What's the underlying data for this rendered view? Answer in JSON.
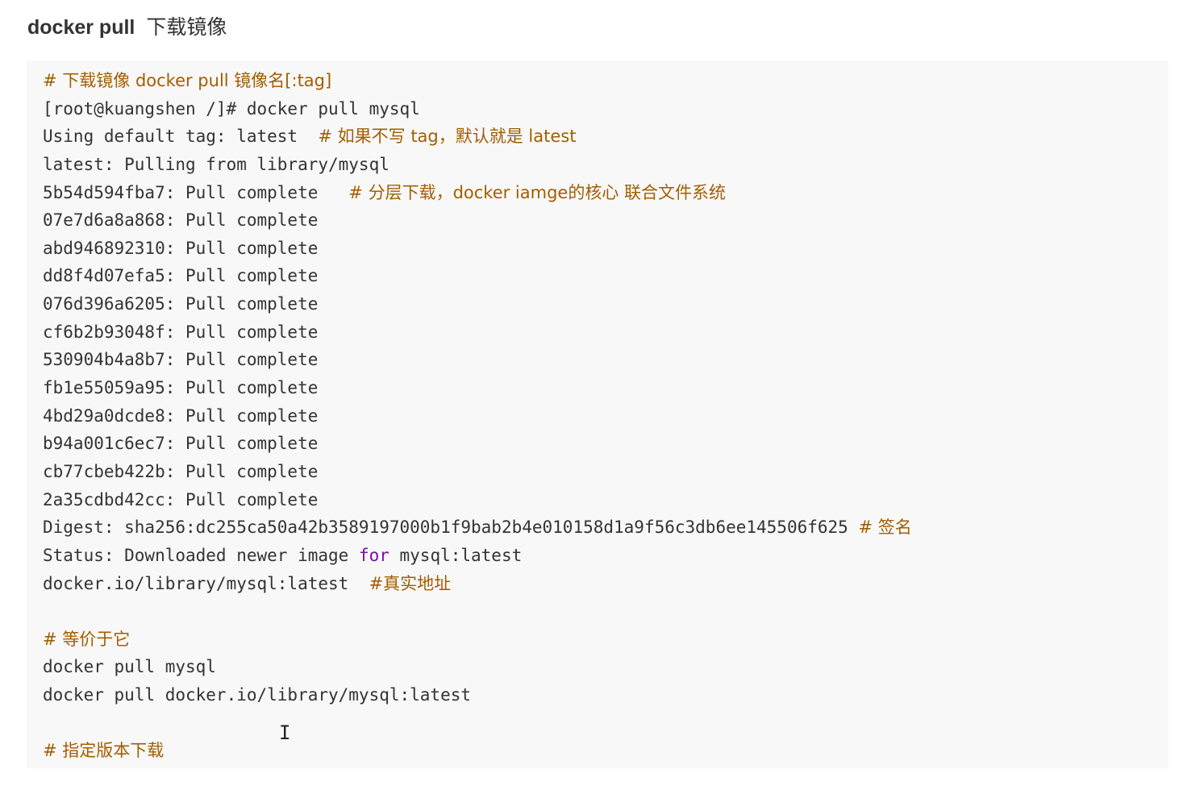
{
  "heading": {
    "command": "docker pull",
    "description": "下载镜像"
  },
  "code": {
    "lines": [
      {
        "text": "",
        "comment": "# 下载镜像 docker pull 镜像名[:tag]"
      },
      {
        "text": "[root@kuangshen /]# docker pull mysql",
        "comment": ""
      },
      {
        "text": "Using default tag: latest  ",
        "comment": "# 如果不写 tag，默认就是 latest"
      },
      {
        "text": "latest: Pulling from library/mysql",
        "comment": ""
      },
      {
        "text": "5b54d594fba7: Pull complete   ",
        "comment": "# 分层下载，docker iamge的核心 联合文件系统"
      },
      {
        "text": "07e7d6a8a868: Pull complete",
        "comment": ""
      },
      {
        "text": "abd946892310: Pull complete",
        "comment": ""
      },
      {
        "text": "dd8f4d07efa5: Pull complete",
        "comment": ""
      },
      {
        "text": "076d396a6205: Pull complete",
        "comment": ""
      },
      {
        "text": "cf6b2b93048f: Pull complete",
        "comment": ""
      },
      {
        "text": "530904b4a8b7: Pull complete",
        "comment": ""
      },
      {
        "text": "fb1e55059a95: Pull complete",
        "comment": ""
      },
      {
        "text": "4bd29a0dcde8: Pull complete",
        "comment": ""
      },
      {
        "text": "b94a001c6ec7: Pull complete",
        "comment": ""
      },
      {
        "text": "cb77cbeb422b: Pull complete",
        "comment": ""
      },
      {
        "text": "2a35cdbd42cc: Pull complete",
        "comment": ""
      },
      {
        "text": "Digest: sha256:dc255ca50a42b3589197000b1f9bab2b4e010158d1a9f56c3db6ee145506f625 ",
        "comment": "# 签名"
      },
      {
        "text_before_keyword": "Status: Downloaded newer image ",
        "keyword": "for",
        "text": " mysql:latest",
        "comment": ""
      },
      {
        "text": "docker.io/library/mysql:latest  ",
        "comment": "#真实地址"
      },
      {
        "text": "",
        "comment": ""
      },
      {
        "text": "",
        "comment": "# 等价于它"
      },
      {
        "text": "docker pull mysql",
        "comment": ""
      },
      {
        "text": "docker pull docker.io/library/mysql:latest",
        "comment": ""
      },
      {
        "text": "",
        "comment": ""
      },
      {
        "text": "",
        "comment": "# 指定版本下载"
      }
    ]
  },
  "colors": {
    "comment": "#a35e00",
    "keyword": "#7a0ea5",
    "code_background": "#f8f8f8",
    "text": "#333333"
  },
  "cursor": {
    "icon": "text-cursor-icon",
    "glyph": "I"
  }
}
